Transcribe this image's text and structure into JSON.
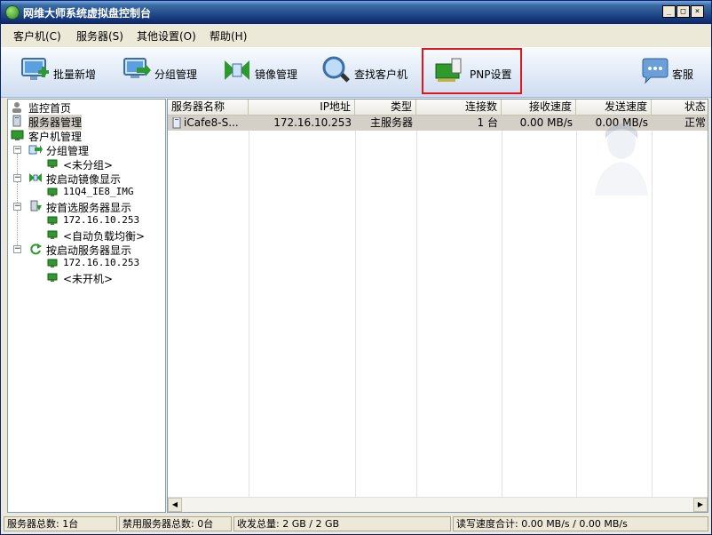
{
  "window": {
    "title": "网维大师系统虚拟盘控制台",
    "controls": {
      "minimize": "_",
      "maximize": "□",
      "close": "×"
    }
  },
  "menu": [
    {
      "label": "客户机(C)"
    },
    {
      "label": "服务器(S)"
    },
    {
      "label": "其他设置(O)"
    },
    {
      "label": "帮助(H)"
    }
  ],
  "toolbar": {
    "batch_add": "批量新增",
    "group_manage": "分组管理",
    "image_manage": "镜像管理",
    "find_client": "查找客户机",
    "pnp_settings": "PNP设置",
    "support": "客服"
  },
  "tree": {
    "monitor_home": "监控首页",
    "server_manage": "服务器管理",
    "client_manage": "客户机管理",
    "group_manage": "分组管理",
    "ungrouped": "<未分组>",
    "by_boot_image": "按启动镜像显示",
    "image_name": "11Q4_IE8_IMG",
    "by_preferred_server": "按首选服务器显示",
    "preferred_ip": "172.16.10.253",
    "auto_balance": "<自动负载均衡>",
    "by_boot_server": "按启动服务器显示",
    "boot_ip": "172.16.10.253",
    "not_powered": "<未开机>"
  },
  "table": {
    "headers": [
      "服务器名称",
      "IP地址",
      "类型",
      "连接数",
      "接收速度",
      "发送速度",
      "状态"
    ],
    "rows": [
      {
        "name": "iCafe8-S...",
        "ip": "172.16.10.253",
        "type": "主服务器",
        "connections": "1 台",
        "recv": "0.00 MB/s",
        "send": "0.00 MB/s",
        "status": "正常"
      }
    ]
  },
  "status": {
    "total_servers": "服务器总数: 1台",
    "disabled_servers": "禁用服务器总数: 0台",
    "transfer_total": "收发总量: 2 GB / 2 GB",
    "rw_speed": "读写速度合计: 0.00 MB/s / 0.00 MB/s"
  },
  "colors": {
    "title_bar": "#0a246a",
    "highlight_box": "#e0161b",
    "selected_row": "#d4d0c8"
  }
}
